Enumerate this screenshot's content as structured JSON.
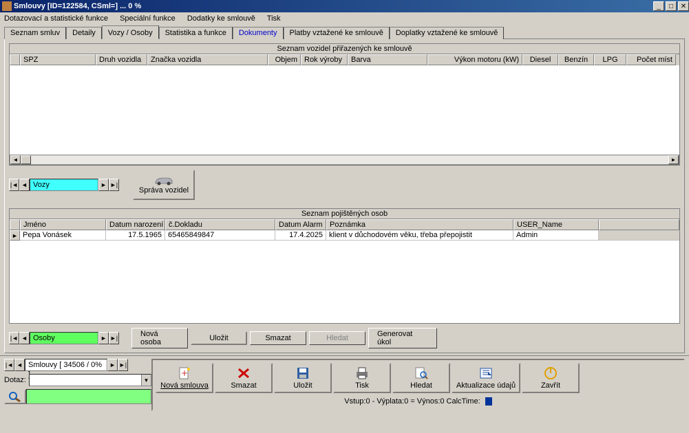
{
  "window": {
    "title": "Smlouvy [ID=122584, CSml=]  ... 0 %"
  },
  "menu": {
    "items": [
      "Dotazovací a statistické funkce",
      "Speciální funkce",
      "Dodatky ke smlouvě",
      "Tisk"
    ]
  },
  "tabs": {
    "items": [
      {
        "label": "Seznam smluv",
        "active": false
      },
      {
        "label": "Detaily",
        "active": false
      },
      {
        "label": "Vozy / Osoby",
        "active": true
      },
      {
        "label": "Statistika a funkce",
        "active": false
      },
      {
        "label": "Dokumenty",
        "active": false,
        "blue": true
      },
      {
        "label": "Platby vztažené ke smlouvě",
        "active": false
      },
      {
        "label": "Doplatky vztažené ke smlouvě",
        "active": false
      }
    ]
  },
  "vehicles_grid": {
    "title": "Seznam vozidel přiřazených ke smlouvě",
    "columns": [
      "SPZ",
      "Druh vozidla",
      "Značka vozidla",
      "Objem",
      "Rok výroby",
      "Barva",
      "Výkon motoru (kW)",
      "Diesel",
      "Benzín",
      "LPG",
      "Počet míst"
    ]
  },
  "nav_vozy": {
    "label": "Vozy"
  },
  "sprava_vozidel": {
    "label": "Správa vozidel"
  },
  "persons_grid": {
    "title": "Seznam pojištěných osob",
    "columns": [
      "Jméno",
      "Datum narození",
      "č.Dokladu",
      "Datum Alarm",
      "Poznámka",
      "USER_Name"
    ],
    "rows": [
      {
        "jmeno": "Pepa Vonásek",
        "narozeni": "17.5.1965",
        "doklad": "65465849847",
        "alarm": "17.4.2025",
        "poznamka": "klient v důchodovém věku, třeba přepojistit",
        "user": "Admin"
      }
    ]
  },
  "nav_osoby": {
    "label": "Osoby"
  },
  "persons_buttons": {
    "nova": "Nová osoba",
    "ulozit": "Uložit",
    "smazat": "Smazat",
    "hledat": "Hledat",
    "ukol": "Generovat úkol"
  },
  "bottom_nav": {
    "label": "Smlouvy [ 34506 / 0% ]"
  },
  "dotaz": {
    "label": "Dotaz:"
  },
  "main_toolbar": {
    "nova": "Nová smlouva",
    "smazat": "Smazat",
    "ulozit": "Uložit",
    "tisk": "Tisk",
    "hledat": "Hledat",
    "aktual": "Aktualizace údajů",
    "zavrit": "Zavřít"
  },
  "status": {
    "text": "Vstup:0 - Výplata:0 = Výnos:0  CalcTime:"
  }
}
